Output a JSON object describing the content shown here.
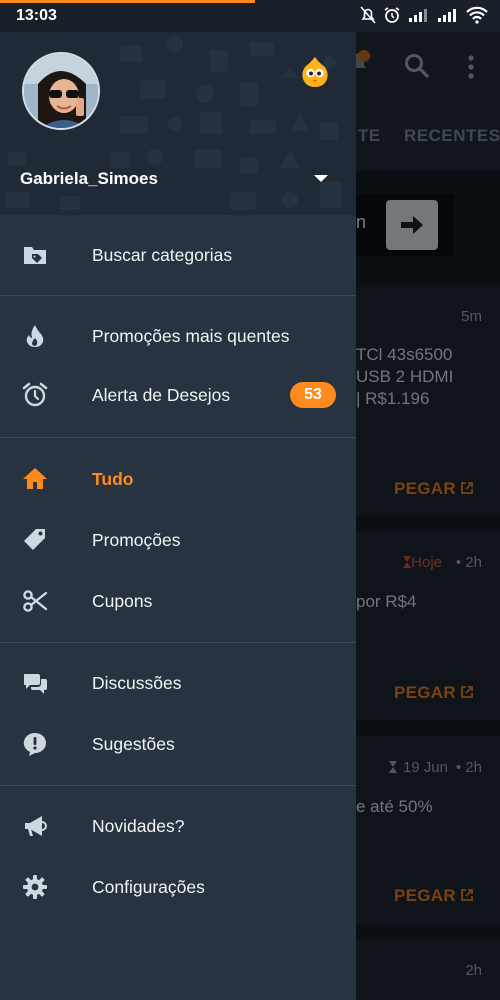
{
  "status_bar": {
    "time": "13:03"
  },
  "background": {
    "tabs": [
      "TE",
      "RECENTES"
    ],
    "search_fragment": "n",
    "cards": [
      {
        "time": "5m",
        "lines": [
          "TCl 43s6500",
          "USB 2 HDMI",
          "| R$1.196"
        ],
        "action": "PEGAR"
      },
      {
        "expiry": "Hoje",
        "time": "• 2h",
        "lines": [
          "por R$4"
        ],
        "action": "PEGAR"
      },
      {
        "expiry": "19 Jun",
        "time": "• 2h",
        "lines": [
          "e até 50%"
        ],
        "action": "PEGAR"
      },
      {
        "time": "2h",
        "lines": []
      }
    ]
  },
  "drawer": {
    "username": "Gabriela_Simoes",
    "menu": [
      {
        "label": "Buscar categorias",
        "icon": "folder-tag-icon"
      },
      {
        "label": "Promoções mais quentes",
        "icon": "flame-icon"
      },
      {
        "label": "Alerta de Desejos",
        "icon": "alarm-clock-icon",
        "badge": "53"
      },
      {
        "label": "Tudo",
        "icon": "home-icon",
        "active": true
      },
      {
        "label": "Promoções",
        "icon": "tag-icon"
      },
      {
        "label": "Cupons",
        "icon": "scissors-icon"
      },
      {
        "label": "Discussões",
        "icon": "chat-bubbles-icon"
      },
      {
        "label": "Sugestões",
        "icon": "alert-bubble-icon"
      },
      {
        "label": "Novidades?",
        "icon": "megaphone-icon"
      },
      {
        "label": "Configurações",
        "icon": "gear-icon"
      }
    ]
  },
  "colors": {
    "accent": "#ff8a1e",
    "drawer_bg": "#273341",
    "header_bg": "#1f2a36"
  }
}
